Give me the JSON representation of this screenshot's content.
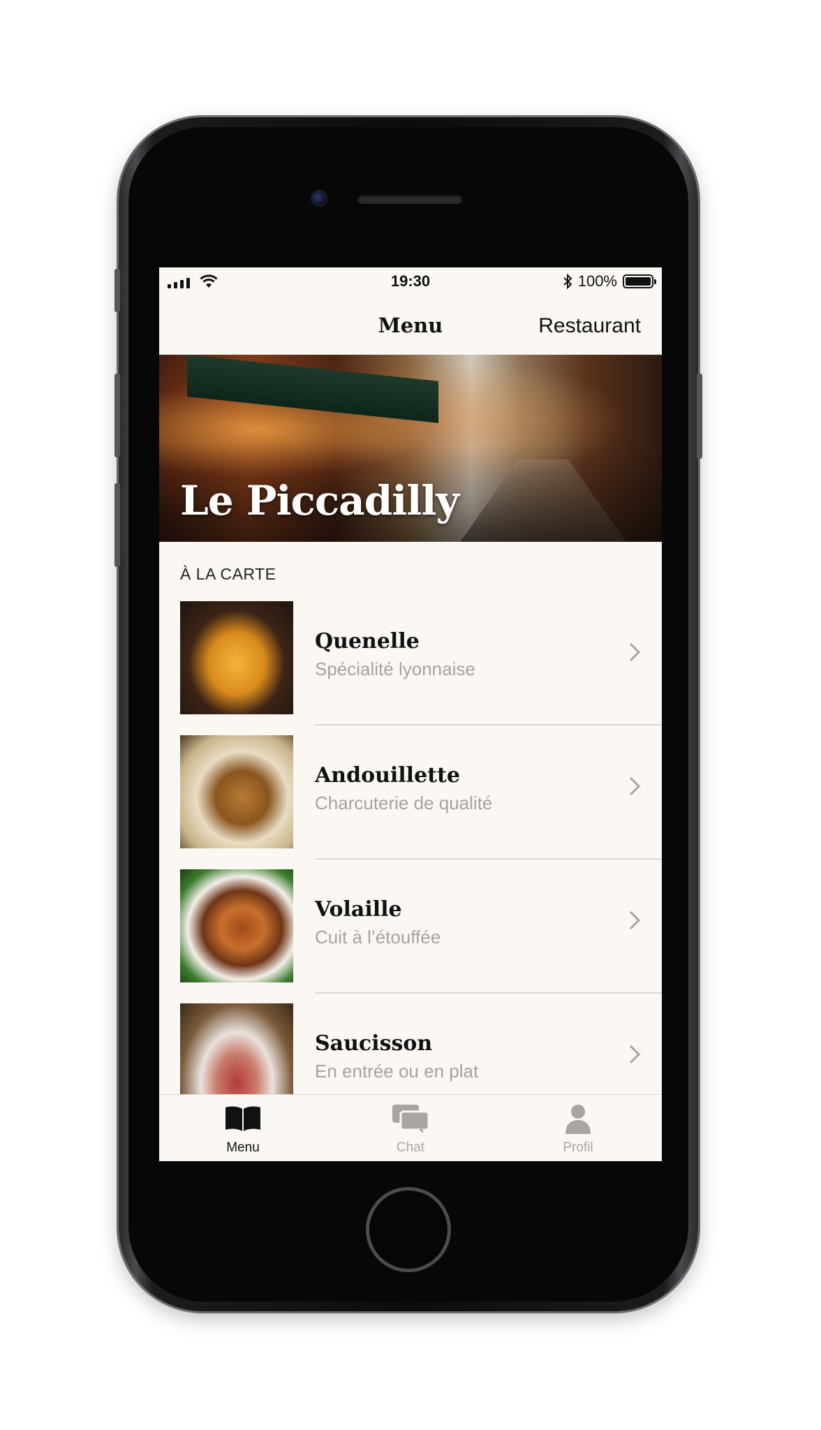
{
  "status_bar": {
    "time": "19:30",
    "battery": "100%",
    "icons": [
      "cellular-signal-icon",
      "wifi-icon",
      "bluetooth-icon",
      "battery-icon"
    ]
  },
  "nav": {
    "title": "Menu",
    "action": "Restaurant"
  },
  "hero": {
    "title": "Le Piccadilly"
  },
  "section": {
    "title": "À LA CARTE"
  },
  "items": [
    {
      "name": "Quenelle",
      "subtitle": "Spécialité lyonnaise",
      "image": "quenelle-photo"
    },
    {
      "name": "Andouillette",
      "subtitle": "Charcuterie de qualité",
      "image": "andouillette-photo"
    },
    {
      "name": "Volaille",
      "subtitle": "Cuit à l’étouffée",
      "image": "volaille-photo"
    },
    {
      "name": "Saucisson",
      "subtitle": "En entrée ou en plat",
      "image": "saucisson-photo"
    }
  ],
  "tabs": [
    {
      "label": "Menu",
      "icon": "book-icon",
      "selected": true
    },
    {
      "label": "Chat",
      "icon": "chat-bubbles-icon",
      "selected": false
    },
    {
      "label": "Profil",
      "icon": "person-icon",
      "selected": false
    }
  ],
  "colors": {
    "background": "#fbf8f3",
    "text": "#111111",
    "subtitle": "#a7a29c",
    "tab_inactive": "#a9a6a1"
  }
}
